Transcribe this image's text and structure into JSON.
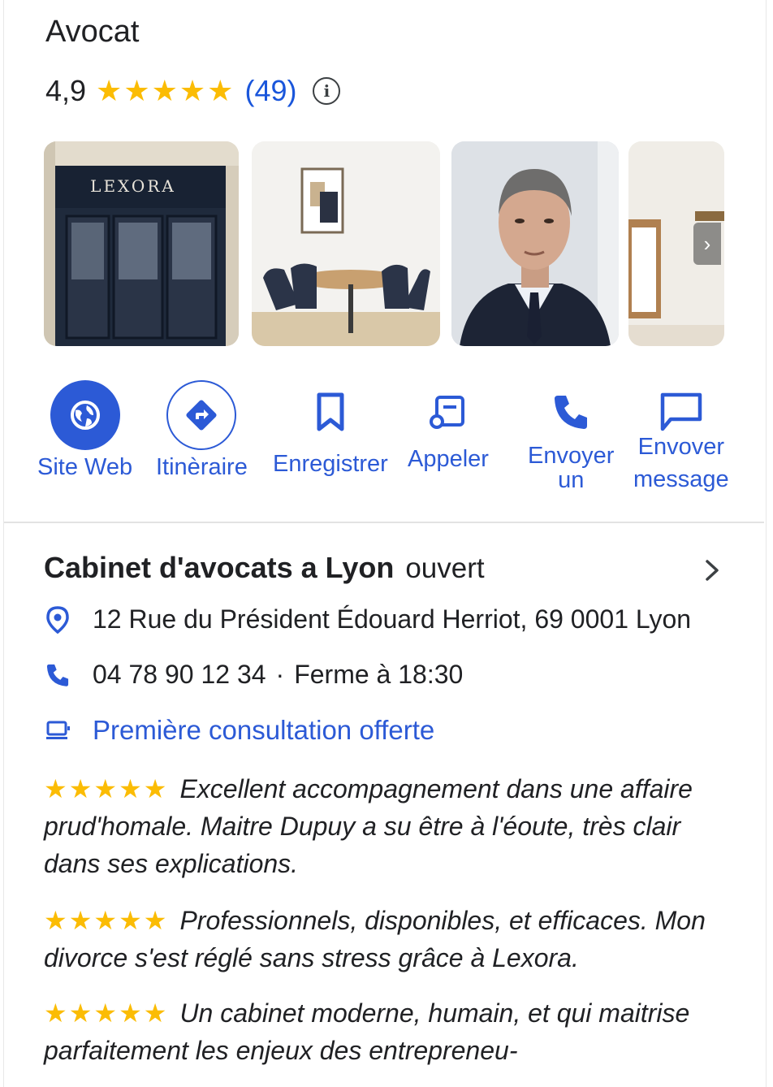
{
  "header": {
    "title": "Avocat",
    "rating": "4,9",
    "stars": [
      "★",
      "★",
      "★",
      "★",
      "★"
    ],
    "review_count": "(49)",
    "info_icon": "i"
  },
  "photos": {
    "storefront_sign": "LEXORA",
    "carousel_arrow": "›"
  },
  "actions": [
    {
      "label": "Site Web",
      "icon": "globe-icon"
    },
    {
      "label": "Itinèraire",
      "icon": "directions-icon"
    },
    {
      "label": "Enregistrer",
      "icon": "bookmark-icon"
    },
    {
      "label": "Appeler",
      "icon": "phone-book-icon"
    },
    {
      "label": "Envoyer\nun",
      "icon": "phone-icon"
    },
    {
      "label": "Envover\nmessage",
      "icon": "message-icon"
    }
  ],
  "business": {
    "name": "Cabinet d'avocats a Lyon",
    "status": "ouvert",
    "address": "12 Rue du Président Édouard Herriot, 69 0001 Lyon",
    "phone": "04 78 90 12 34",
    "separator": "·",
    "hours": "Ferme à 18:30",
    "promo": "Première consultation offerte"
  },
  "reviews": [
    {
      "stars": "★★★★★",
      "text": "Excellent accompagnement dans une affaire prud'homale. Maitre Dupuy a su être à l'éoute, très clair dans ses explications."
    },
    {
      "stars": "★★★★★",
      "text": "Professionnels, disponibles, et efficaces. Mon divorce s'est réglé sans stress grâce à Lexora."
    },
    {
      "stars": "★★★★★",
      "text": "Un cabinet moderne, humain, et qui maitrise parfaitement les enjeux des entrepreneu-"
    }
  ],
  "colors": {
    "accent": "#2c5ad6",
    "star": "#fbbc04",
    "text": "#202124"
  }
}
